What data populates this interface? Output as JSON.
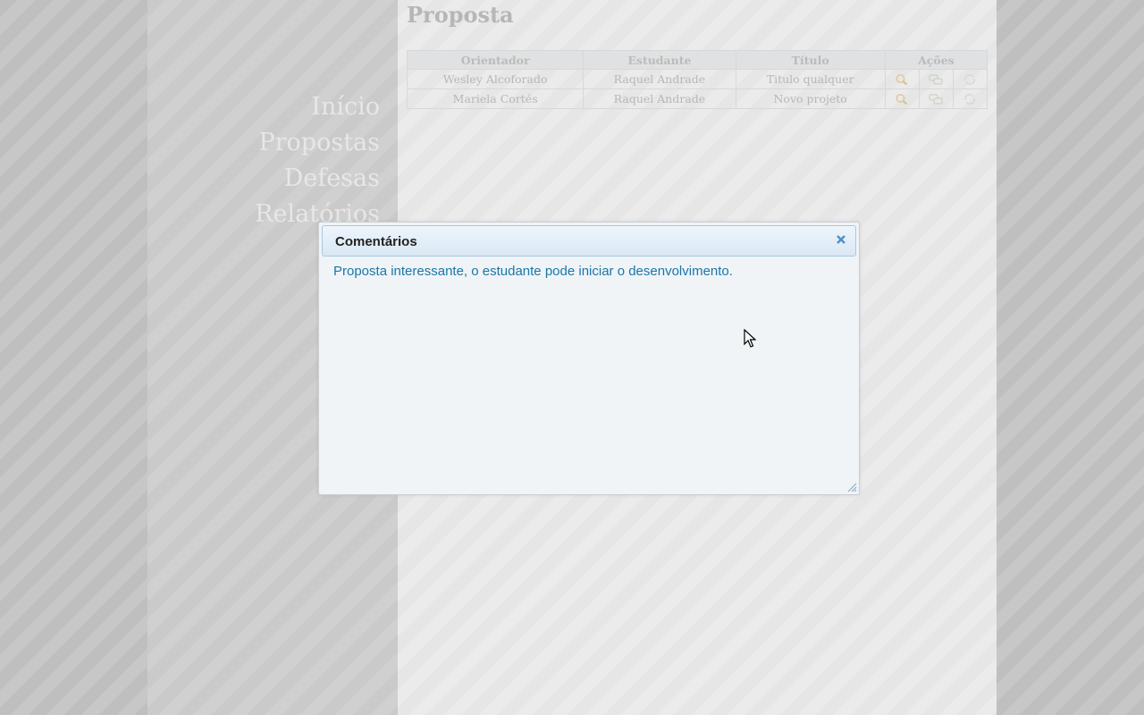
{
  "nav": {
    "items": [
      {
        "label": "Início"
      },
      {
        "label": "Propostas"
      },
      {
        "label": "Defesas"
      },
      {
        "label": "Relatórios"
      }
    ]
  },
  "page": {
    "title": "Proposta"
  },
  "table": {
    "headers": [
      "Orientador",
      "Estudante",
      "Título",
      "Ações"
    ],
    "rows": [
      {
        "orientador": "Wesley Alcoforado",
        "estudante": "Raquel Andrade",
        "titulo": "Titulo qualquer",
        "actions": [
          "view-icon",
          "comments-icon",
          "refresh-icon"
        ]
      },
      {
        "orientador": "Mariela Cortés",
        "estudante": "Raquel Andrade",
        "titulo": "Novo projeto",
        "actions": [
          "view-icon",
          "comments-icon",
          "refresh-icon"
        ]
      }
    ]
  },
  "dialog": {
    "title": "Comentários",
    "body": "Proposta interessante, o estudante pode iniciar o desenvolvimento.",
    "close_icon": "close-icon"
  },
  "colors": {
    "dialog_text": "#1b76a6",
    "dialog_header_border": "#a6c9e2",
    "close_icon": "#4f8fc6"
  }
}
